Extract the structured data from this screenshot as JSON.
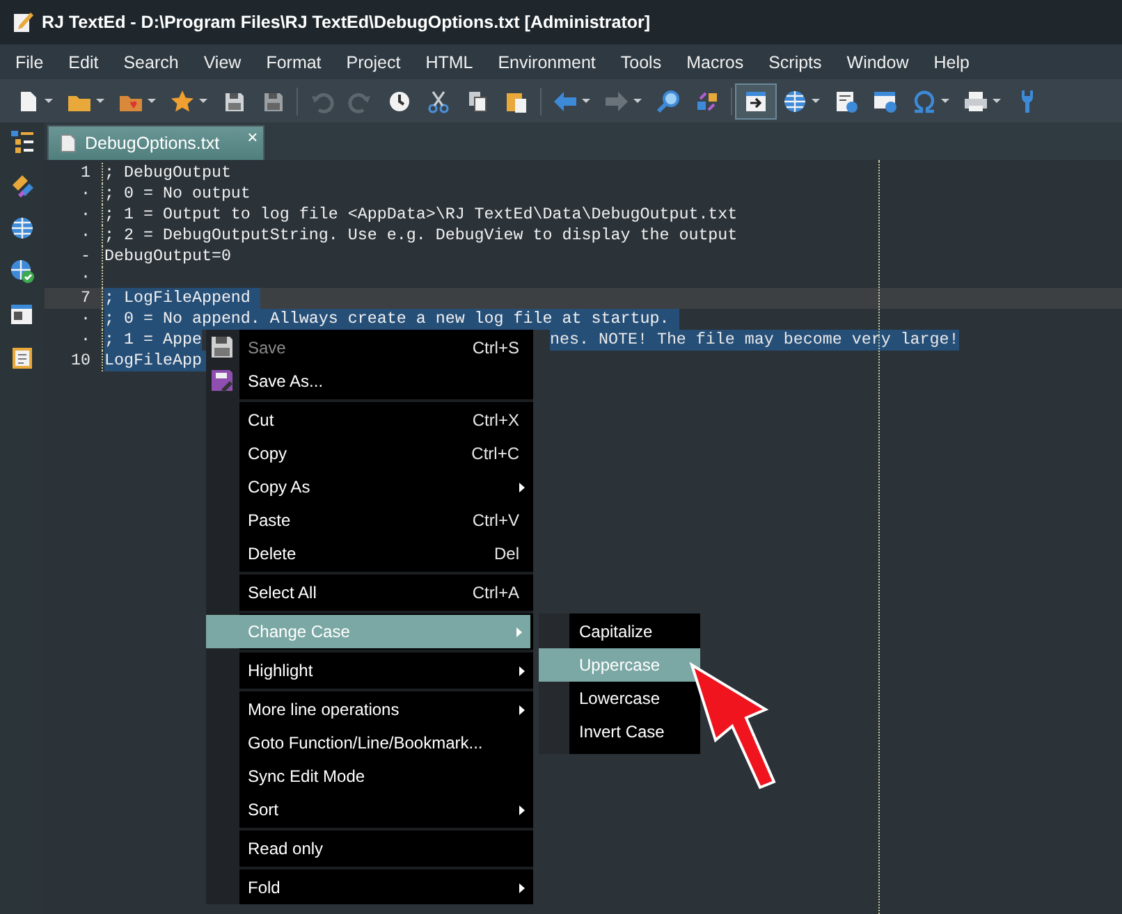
{
  "window": {
    "title": "RJ TextEd - D:\\Program Files\\RJ TextEd\\DebugOptions.txt [Administrator]"
  },
  "menu": [
    "File",
    "Edit",
    "Search",
    "View",
    "Format",
    "Project",
    "HTML",
    "Environment",
    "Tools",
    "Macros",
    "Scripts",
    "Window",
    "Help"
  ],
  "tabs": [
    {
      "label": "DebugOptions.txt",
      "selected": true,
      "close": "×"
    }
  ],
  "editor": {
    "lines": [
      {
        "gutter": "1",
        "text": "; DebugOutput",
        "selected": false,
        "current": false
      },
      {
        "gutter": "·",
        "text": "; 0 = No output",
        "selected": false,
        "current": false
      },
      {
        "gutter": "·",
        "text": "; 1 = Output to log file <AppData>\\RJ TextEd\\Data\\DebugOutput.txt",
        "selected": false,
        "current": false
      },
      {
        "gutter": "·",
        "text": "; 2 = DebugOutputString. Use e.g. DebugView to display the output",
        "selected": false,
        "current": false
      },
      {
        "gutter": "-",
        "text": "DebugOutput=0",
        "selected": false,
        "current": false
      },
      {
        "gutter": "·",
        "selected": false,
        "current": false
      },
      {
        "gutter": "7",
        "text": "; LogFileAppend",
        "selected": true,
        "current": true
      },
      {
        "gutter": "·",
        "text": "; 0 = No append. Allways create a new log file at startup.",
        "selected": true,
        "current": false
      },
      {
        "gutter": "·",
        "text": "; 1 = Appe",
        "tail": "nes. NOTE! The file may become very large!",
        "selected": true,
        "current": false
      },
      {
        "gutter": "10",
        "text": "LogFileApp",
        "selected": true,
        "current": false
      }
    ]
  },
  "context_menu": {
    "items": [
      {
        "kind": "icon_item",
        "label": "Save",
        "shortcut": "Ctrl+S",
        "disabled": true,
        "submenu": false,
        "selected": false
      },
      {
        "kind": "icon_item",
        "label": "Save As...",
        "disabled": false,
        "submenu": false,
        "selected": false
      },
      {
        "kind": "separator"
      },
      {
        "kind": "item",
        "label": "Cut",
        "shortcut": "Ctrl+X",
        "disabled": false,
        "submenu": false,
        "selected": false
      },
      {
        "kind": "item",
        "label": "Copy",
        "shortcut": "Ctrl+C",
        "disabled": false,
        "submenu": false,
        "selected": false
      },
      {
        "kind": "item",
        "label": "Copy As",
        "disabled": false,
        "submenu": true,
        "selected": false
      },
      {
        "kind": "item",
        "label": "Paste",
        "shortcut": "Ctrl+V",
        "disabled": false,
        "submenu": false,
        "selected": false
      },
      {
        "kind": "item",
        "label": "Delete",
        "shortcut": "Del",
        "disabled": false,
        "submenu": false,
        "selected": false
      },
      {
        "kind": "separator"
      },
      {
        "kind": "item",
        "label": "Select All",
        "shortcut": "Ctrl+A",
        "disabled": false,
        "submenu": false,
        "selected": false
      },
      {
        "kind": "separator"
      },
      {
        "kind": "item",
        "label": "Change Case",
        "disabled": false,
        "submenu": true,
        "selected": true
      },
      {
        "kind": "separator"
      },
      {
        "kind": "item",
        "label": "Highlight",
        "disabled": false,
        "submenu": true,
        "selected": false
      },
      {
        "kind": "separator"
      },
      {
        "kind": "item",
        "label": "More line operations",
        "disabled": false,
        "submenu": true,
        "selected": false
      },
      {
        "kind": "item",
        "label": "Goto Function/Line/Bookmark...",
        "disabled": false,
        "submenu": false,
        "selected": false
      },
      {
        "kind": "item",
        "label": "Sync Edit Mode",
        "disabled": false,
        "submenu": false,
        "selected": false
      },
      {
        "kind": "item",
        "label": "Sort",
        "disabled": false,
        "submenu": true,
        "selected": false
      },
      {
        "kind": "separator"
      },
      {
        "kind": "item",
        "label": "Read only",
        "disabled": false,
        "submenu": false,
        "selected": false
      },
      {
        "kind": "separator"
      },
      {
        "kind": "item",
        "label": "Fold",
        "disabled": false,
        "submenu": true,
        "selected": false
      }
    ]
  },
  "submenu": {
    "items": [
      {
        "label": "Capitalize",
        "selected": false
      },
      {
        "label": "Uppercase",
        "selected": true
      },
      {
        "label": "Lowercase",
        "selected": false
      },
      {
        "label": "Invert Case",
        "selected": false
      }
    ]
  }
}
